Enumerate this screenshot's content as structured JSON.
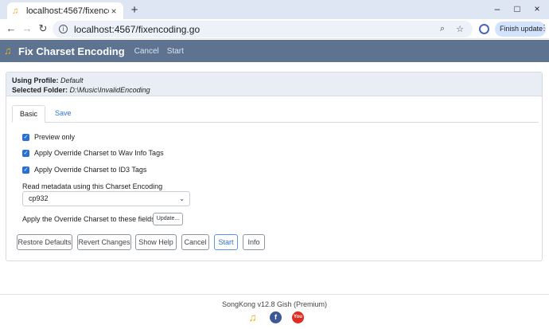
{
  "browser": {
    "tab_title": "localhost:4567/fixencoding.go",
    "url": "localhost:4567/fixencoding.go",
    "finish_update": "Finish update"
  },
  "app": {
    "title": "Fix Charset Encoding",
    "nav": [
      "Cancel",
      "Start"
    ]
  },
  "profile": {
    "profile_label": "Using Profile:",
    "profile_value": "Default",
    "folder_label": "Selected Folder:",
    "folder_value": "D:\\Music\\InvalidEncoding"
  },
  "tabs": [
    "Basic",
    "Save"
  ],
  "options": [
    {
      "label": "Preview only",
      "checked": true
    },
    {
      "label": "Apply Override Charset to Wav Info Tags",
      "checked": true
    },
    {
      "label": "Apply Override Charset to ID3 Tags",
      "checked": true
    }
  ],
  "charset": {
    "label": "Read metadata using this Charset Encoding",
    "value": "cp932"
  },
  "fields": {
    "label": "Apply the Override Charset to these fields",
    "button": "Update..."
  },
  "actions": [
    "Restore Defaults",
    "Revert Changes",
    "Show Help",
    "Cancel",
    "Start",
    "Info"
  ],
  "footer": {
    "version": "SongKong v12.8 Gish (Premium)"
  },
  "colors": {
    "appbar": "#5d7390",
    "accent": "#2a6fd6"
  }
}
